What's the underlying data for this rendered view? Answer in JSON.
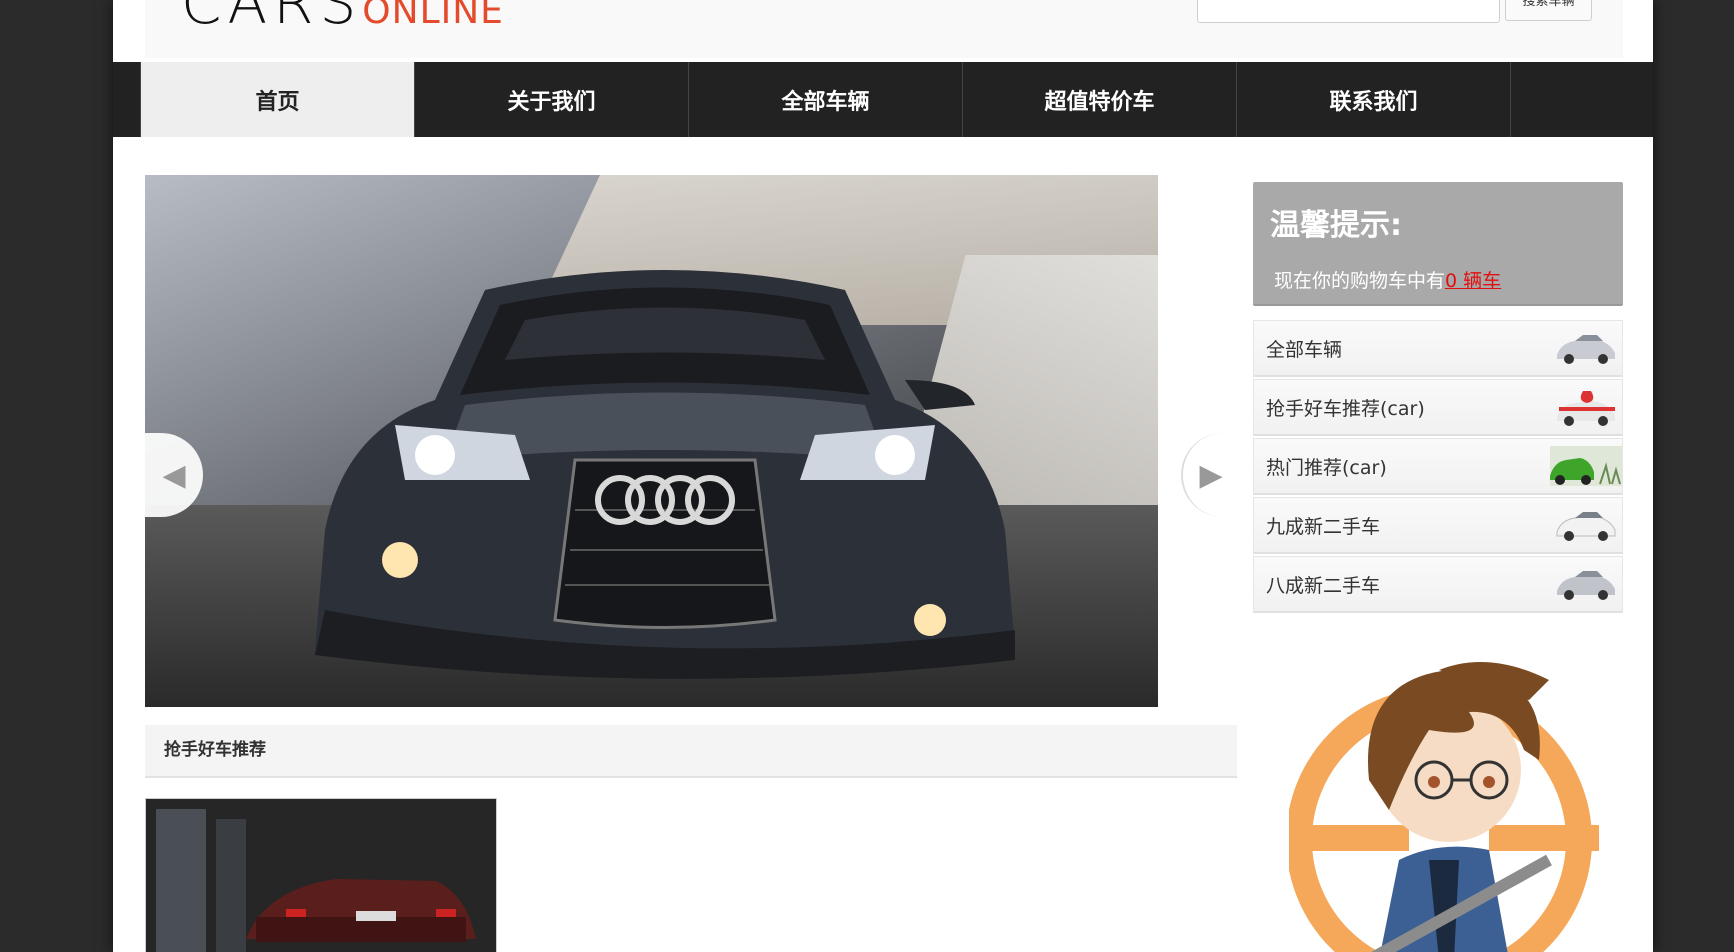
{
  "header": {
    "logo_main": "CARS",
    "logo_sub": "ONLINE",
    "search_button": "搜索车辆",
    "search_placeholder": ""
  },
  "nav": {
    "items": [
      {
        "label": "首页",
        "active": true
      },
      {
        "label": "关于我们",
        "active": false
      },
      {
        "label": "全部车辆",
        "active": false
      },
      {
        "label": "超值特价车",
        "active": false
      },
      {
        "label": "联系我们",
        "active": false
      }
    ]
  },
  "slider": {
    "prev_icon": "triangle-left-icon",
    "next_icon": "triangle-right-icon"
  },
  "section": {
    "title": "抢手好车推荐"
  },
  "sidebar": {
    "notice_title": "温馨提示:",
    "notice_text": "现在你的购物车中有",
    "cart_link": "0 辆车",
    "items": [
      {
        "label": "全部车辆",
        "icon": "silver-car-icon"
      },
      {
        "label": "抢手好车推荐(car)",
        "icon": "gift-car-icon"
      },
      {
        "label": "热门推荐(car)",
        "icon": "green-car-icon"
      },
      {
        "label": "九成新二手车",
        "icon": "white-car-icon"
      },
      {
        "label": "八成新二手车",
        "icon": "silver-car-icon"
      }
    ]
  },
  "colors": {
    "nav_bg": "#222222",
    "logo_accent": "#e44b2c",
    "link_red": "#e01010",
    "notice_bg": "#a9a9a9"
  }
}
